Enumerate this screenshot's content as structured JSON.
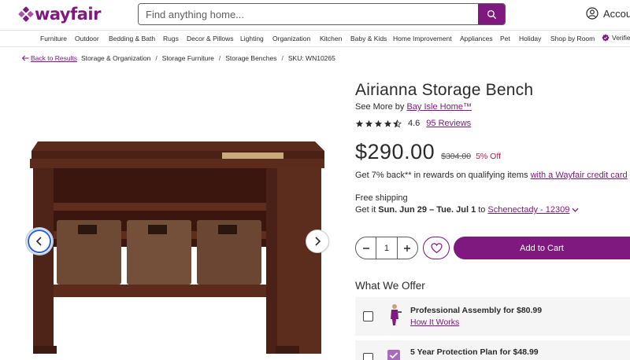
{
  "header": {
    "logo_text": "wayfair",
    "search_placeholder": "Find anything home...",
    "account_label": "Account"
  },
  "nav": {
    "items": [
      "Furniture",
      "Outdoor",
      "Bedding & Bath",
      "Rugs",
      "Decor & Pillows",
      "Lighting",
      "Organization",
      "Kitchen",
      "Baby & Kids",
      "Home Improvement",
      "Appliances",
      "Pet",
      "Holiday",
      "Shop by Room"
    ],
    "verified_label": "Verified"
  },
  "breadcrumb": {
    "back_label": "Back to Results",
    "crumbs": [
      "Storage & Organization",
      "Storage Furniture",
      "Storage Benches"
    ],
    "sep": "/",
    "sku": "SKU: WN10265"
  },
  "product": {
    "title": "Airianna Storage Bench",
    "see_more_prefix": "See More by",
    "brand": "Bay Isle Home™",
    "rating": "4.6",
    "rating_value": 4.6,
    "reviews_label": "95 Reviews",
    "price": "$290.00",
    "old_price": "$304.00",
    "discount": "5% Off",
    "rewards_text": "Get 7% back** in rewards on qualifying items",
    "rewards_link": "with a Wayfair credit card",
    "shipping": "Free shipping",
    "delivery_prefix": "Get it",
    "delivery_dates": "Sun. Jun 29 – Tue. Jul 1",
    "delivery_to": "to",
    "delivery_zip": "Schenectady - 12309",
    "quantity": "1",
    "add_to_cart": "Add to Cart"
  },
  "offers": {
    "title": "What We Offer",
    "items": [
      {
        "label": "Professional Assembly for $80.99",
        "link": "How It Works"
      },
      {
        "label": "5 Year Protection Plan for $48.99"
      }
    ]
  },
  "colors": {
    "brand": "#7f187f",
    "discount": "#b6213f",
    "focus": "#2f5fd7"
  }
}
